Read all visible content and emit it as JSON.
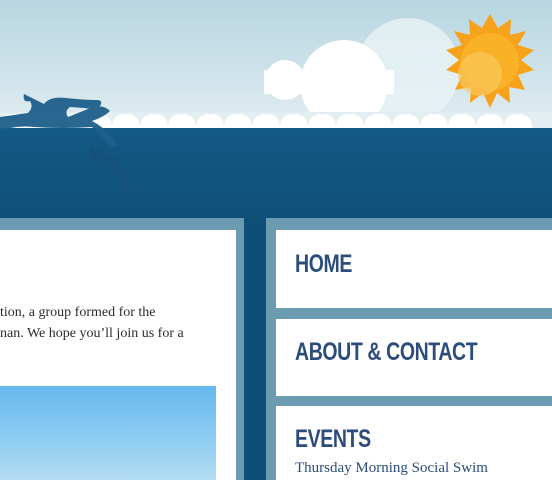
{
  "intro": {
    "line1": "tion, a group formed for the",
    "line2": "nan. We hope you’ll join us for a"
  },
  "nav": {
    "home": "HOME",
    "about": "ABOUT & CONTACT",
    "events": "EVENTS"
  },
  "events": {
    "first_event": "Thursday Morning Social Swim"
  },
  "colors": {
    "sea": "#0f4f77",
    "sky": "#cfe3ea",
    "sun": "#f7a21b",
    "nav_text": "#2c4d7c",
    "band": "#6a9bb1"
  },
  "icons": {
    "sun": "sun-icon",
    "cloud": "cloud-icon",
    "swimmer": "swimmer-icon"
  }
}
